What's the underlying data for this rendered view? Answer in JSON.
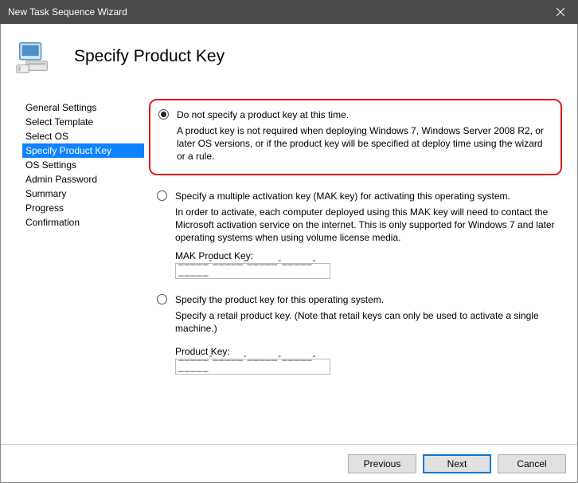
{
  "window": {
    "title": "New Task Sequence Wizard"
  },
  "header": {
    "title": "Specify Product Key"
  },
  "sidebar": {
    "items": [
      {
        "label": "General Settings"
      },
      {
        "label": "Select Template"
      },
      {
        "label": "Select OS"
      },
      {
        "label": "Specify Product Key",
        "selected": true
      },
      {
        "label": "OS Settings"
      },
      {
        "label": "Admin Password"
      },
      {
        "label": "Summary"
      },
      {
        "label": "Progress"
      },
      {
        "label": "Confirmation"
      }
    ]
  },
  "options": {
    "opt1": {
      "label": "Do not specify a product key at this time.",
      "desc": "A product key is not required when deploying Windows 7, Windows Server 2008 R2, or later OS versions, or if the product key will be specified at deploy time using the wizard or a rule.",
      "selected": true
    },
    "opt2": {
      "label": "Specify a multiple activation key (MAK key) for activating this operating system.",
      "desc": "In order to activate, each computer deployed using this MAK key will need to contact the Microsoft activation service on the internet.  This is only supported for Windows 7 and later operating systems when using volume license media.",
      "fieldLabel": "MAK Product Key:",
      "value": "_____-_____-_____-_____-_____"
    },
    "opt3": {
      "label": "Specify the product key for this operating system.",
      "desc": "Specify a retail product key.  (Note that retail keys can only be used to activate a single machine.)",
      "fieldLabel": "Product Key:",
      "value": "_____-_____-_____-_____-_____"
    }
  },
  "footer": {
    "previous": "Previous",
    "next": "Next",
    "cancel": "Cancel"
  }
}
